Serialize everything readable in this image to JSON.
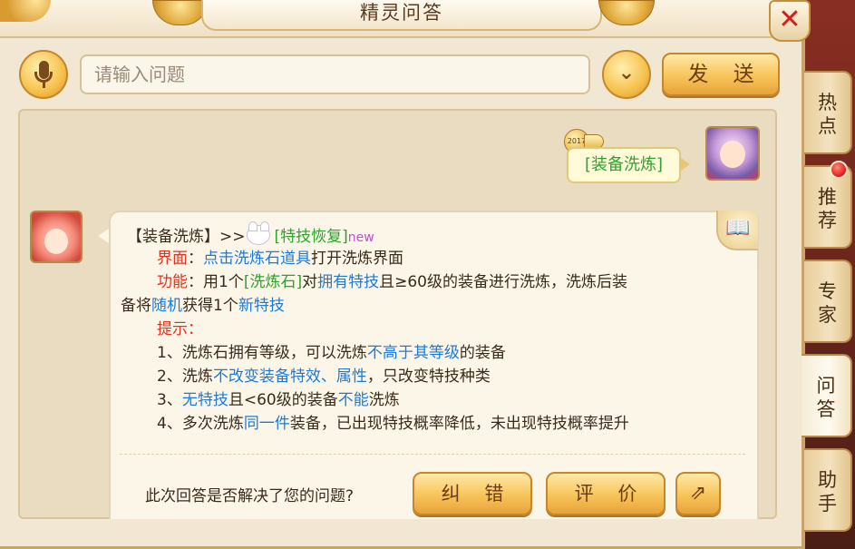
{
  "window": {
    "title": "精灵问答",
    "close_symbol": "✕"
  },
  "input_row": {
    "placeholder": "请输入问题",
    "dropdown_symbol": "⌄",
    "send_label": "发 送"
  },
  "user_message": {
    "badge": "2017",
    "text": "[装备洗炼]"
  },
  "bot_message": {
    "header_prefix": "【装备洗炼】>>",
    "header_link": "[特技恢复]",
    "header_new": "new",
    "line_interface": {
      "label": "界面",
      "colon": "：",
      "link": "点击洗炼石道具",
      "rest": "打开洗炼界面"
    },
    "line_function": {
      "label": "功能",
      "t1": "：用1个",
      "item": "[洗炼石]",
      "t2": "对",
      "k1": "拥有特技",
      "t3": "且≥60级的装备进行洗炼，洗炼后装",
      "t4": "备将",
      "k2": "随机",
      "t5": "获得1个",
      "k3": "新特技"
    },
    "tips_label": "提示：",
    "tip1": {
      "a": "1、洗炼石拥有等级，可以洗炼",
      "b": "不高于其等级",
      "c": "的装备"
    },
    "tip2": {
      "a": "2、洗炼",
      "b": "不改变装备特效、属性",
      "c": "，只改变特技种类"
    },
    "tip3": {
      "a": "3、",
      "b": "无特技",
      "c": "且<60级的装备",
      "d": "不能",
      "e": "洗炼"
    },
    "tip4": {
      "a": "4、多次洗炼",
      "b": "同一件",
      "c": "装备，已出现特技概率降低，未出现特技概率提升"
    }
  },
  "feedback": {
    "question": "此次回答是否解决了您的问题?",
    "correct_label": "纠 错",
    "rate_label": "评 价",
    "share_symbol": "⇗"
  },
  "side_tabs": [
    {
      "label": "热\n点"
    },
    {
      "label": "推\n荐"
    },
    {
      "label": "专\n家"
    },
    {
      "label": "问\n答"
    },
    {
      "label": "助\n手"
    }
  ],
  "colors": {
    "keyword_red": "#e2331f",
    "keyword_blue": "#1f7ad6",
    "item_green": "#2aa52a",
    "new_pink": "#c84ad8"
  }
}
